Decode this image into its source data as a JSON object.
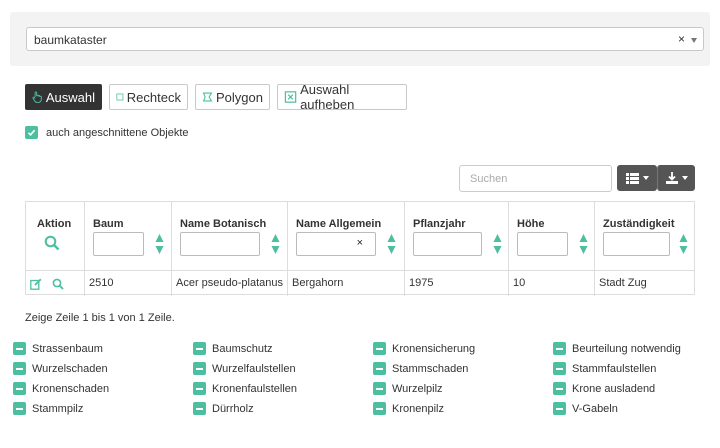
{
  "layer_select": {
    "value": "baumkataster",
    "clear_glyph": "×"
  },
  "toolbar": {
    "auswahl": "Auswahl",
    "rechteck": "Rechteck",
    "polygon": "Polygon",
    "aufheben": "Auswahl aufheben"
  },
  "options": {
    "angeschnittene": "auch angeschnittene Objekte"
  },
  "search": {
    "placeholder": "Suchen"
  },
  "table": {
    "headers": {
      "aktion": "Aktion",
      "baum": "Baum",
      "name_botanisch": "Name Botanisch",
      "name_allgemein": "Name Allgemein",
      "pflanzjahr": "Pflanzjahr",
      "hoehe": "Höhe",
      "zustaendigkeit": "Zuständigkeit"
    },
    "filter_clear_glyph": "×",
    "rows": [
      {
        "baum": "2510",
        "name_botanisch": "Acer pseudo-platanus",
        "name_allgemein": "Bergahorn",
        "pflanzjahr": "1975",
        "hoehe": "10",
        "zustaendigkeit": "Stadt Zug"
      }
    ]
  },
  "footer": {
    "summary": "Zeige Zeile 1 bis 1 von 1 Zeile."
  },
  "legend": [
    "Strassenbaum",
    "Baumschutz",
    "Kronensicherung",
    "Beurteilung notwendig",
    "Wurzelschaden",
    "Wurzelfaulstellen",
    "Stammschaden",
    "Stammfaulstellen",
    "Kronenschaden",
    "Kronenfaulstellen",
    "Wurzelpilz",
    "Krone ausladend",
    "Stammpilz",
    "Dürrholz",
    "Kronenpilz",
    "V-Gabeln"
  ],
  "colors": {
    "accent": "#4bbfa0",
    "active_button": "#333333",
    "dropdown_button": "#555555"
  },
  "icons": [
    "hand-pointer-icon",
    "square-icon",
    "polygon-icon",
    "close-box-icon",
    "check-icon",
    "search-icon",
    "edit-icon",
    "sort-icon",
    "columns-icon",
    "download-icon",
    "minus-icon",
    "chevron-down-icon"
  ]
}
